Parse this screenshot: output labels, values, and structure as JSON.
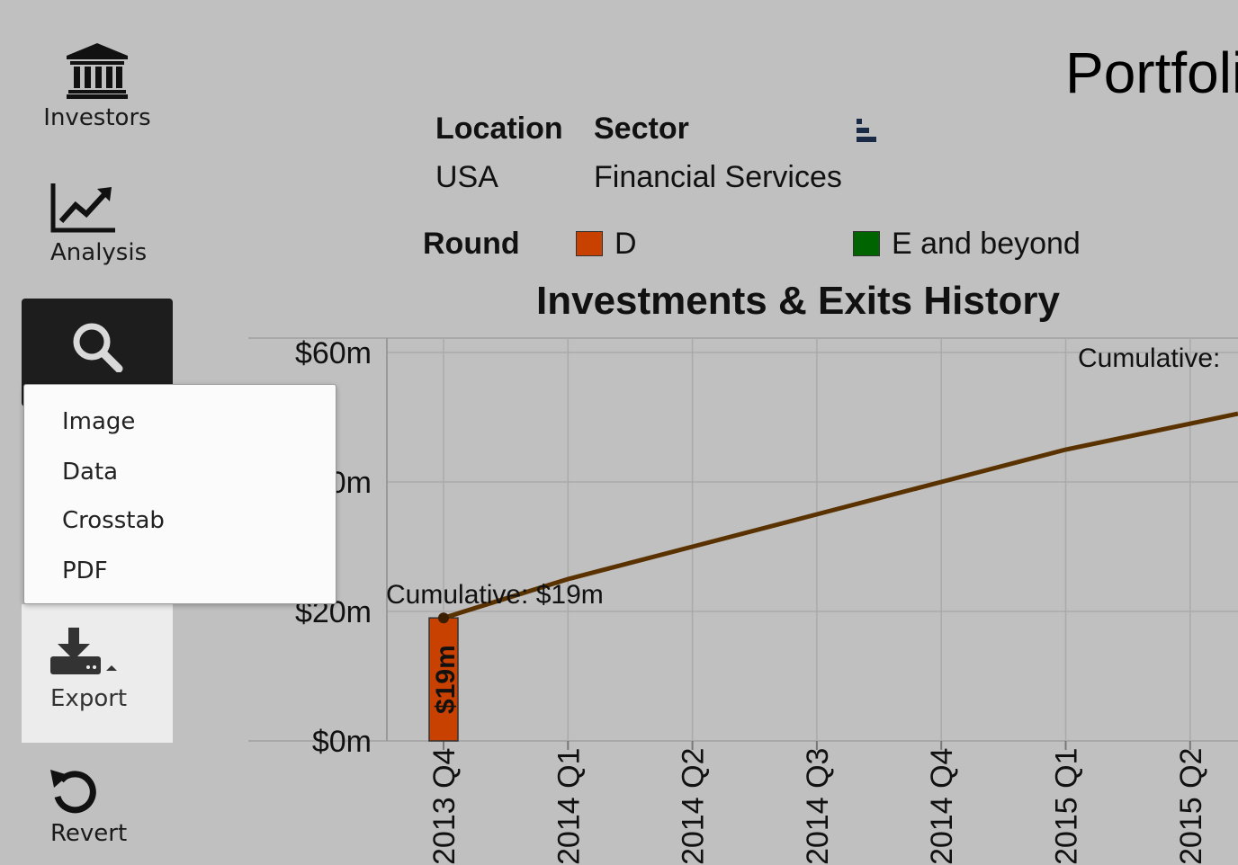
{
  "sidebar": {
    "investors_label": "Investors",
    "analysis_label": "Analysis",
    "export_label": "Export",
    "revert_label": "Revert"
  },
  "export_menu": {
    "items": [
      "Image",
      "Data",
      "Crosstab",
      "PDF"
    ]
  },
  "header": {
    "title": "Portfoli",
    "location_label": "Location",
    "location_value": "USA",
    "sector_label": "Sector",
    "sector_value": "Financial Services",
    "round_label": "Round",
    "legend": [
      {
        "label": "D",
        "color": "#c84100"
      },
      {
        "label": "E and beyond",
        "color": "#006400"
      }
    ]
  },
  "chart_data": {
    "type": "bar",
    "title": "Investments & Exits History",
    "categories": [
      "2013 Q4",
      "2014 Q1",
      "2014 Q2",
      "2014 Q3",
      "2014 Q4",
      "2015 Q1",
      "2015 Q2"
    ],
    "y_ticks": [
      "$0m",
      "$20m",
      "$40m",
      "$60m"
    ],
    "ylim": [
      0,
      60
    ],
    "grid": true,
    "series": [
      {
        "name": "D",
        "type": "bar",
        "color": "#c84100",
        "values": [
          19,
          0,
          0,
          0,
          0,
          0,
          0
        ],
        "labels": [
          "$19m"
        ]
      },
      {
        "type": "line",
        "color": "#5a3200",
        "values": [
          19,
          25,
          30,
          35,
          40,
          45,
          49
        ]
      }
    ],
    "annotations": [
      "Cumulative: $19m",
      "Cumulative:"
    ]
  }
}
